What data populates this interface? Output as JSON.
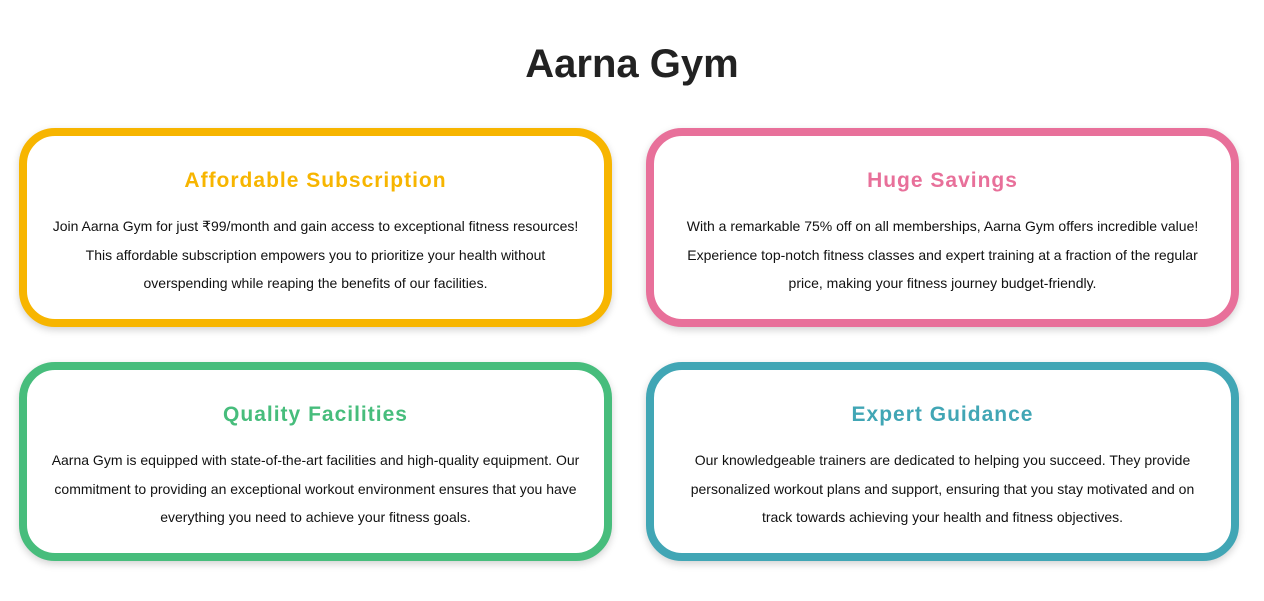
{
  "page": {
    "title": "Aarna Gym"
  },
  "cards": [
    {
      "title": "Affordable Subscription",
      "color": "#F7B500",
      "lines": [
        "Join Aarna Gym for just ₹99/month and gain access to exceptional fitness resources!",
        "This affordable subscription empowers you to prioritize your health without",
        "overspending while reaping the benefits of our facilities."
      ]
    },
    {
      "title": "Huge Savings",
      "color": "#E8709A",
      "lines": [
        "With a remarkable 75% off on all memberships, Aarna Gym offers incredible value!",
        "Experience top-notch fitness classes and expert training at a fraction of the regular",
        "price, making your fitness journey budget-friendly."
      ]
    },
    {
      "title": "Quality Facilities",
      "color": "#47BD7C",
      "lines": [
        "Aarna Gym is equipped with state-of-the-art facilities and high-quality equipment. Our",
        "commitment to providing an exceptional workout environment ensures that you have",
        "everything you need to achieve your fitness goals."
      ]
    },
    {
      "title": "Expert Guidance",
      "color": "#41A6B5",
      "lines": [
        "Our knowledgeable trainers are dedicated to helping you succeed. They provide",
        "personalized workout plans and support, ensuring that you stay motivated and on",
        "track towards achieving your health and fitness objectives."
      ]
    }
  ]
}
